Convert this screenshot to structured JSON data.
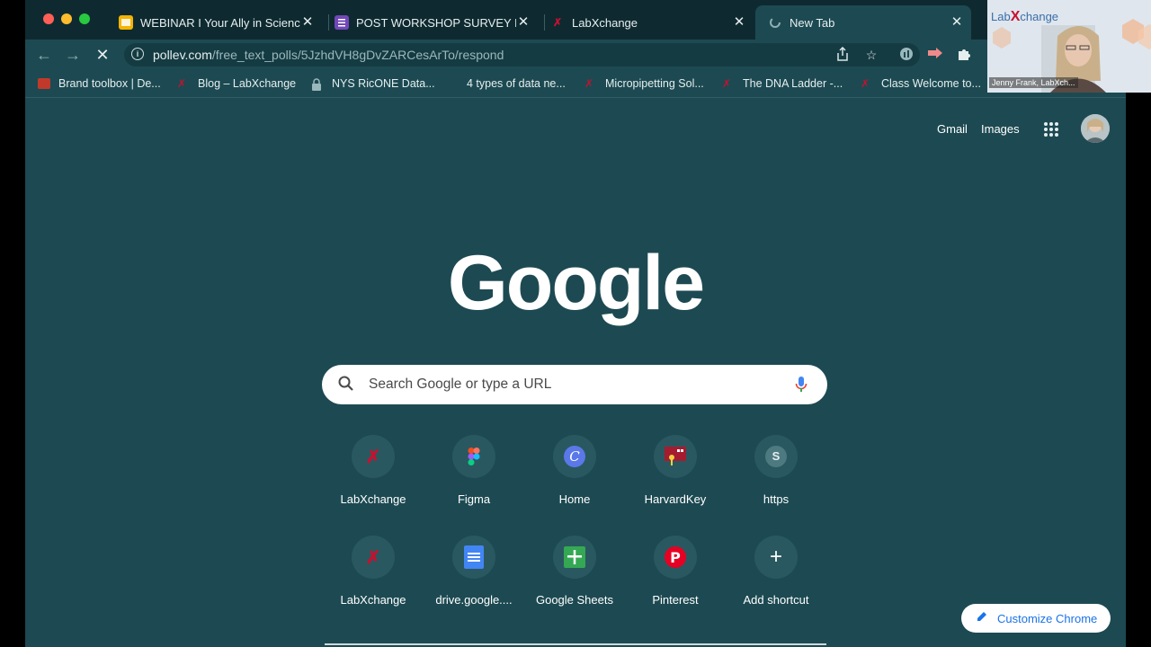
{
  "window": {
    "traffic_colors": [
      "#ff5f57",
      "#febc2e",
      "#28c840"
    ],
    "tabs": [
      {
        "title": "WEBINAR I Your Ally in Science",
        "icon": "slides-icon",
        "color": "#f4b400"
      },
      {
        "title": "POST WORKSHOP SURVEY I A",
        "icon": "forms-icon",
        "color": "#7248b9"
      },
      {
        "title": "LabXchange",
        "icon": "labxchange-icon",
        "color": "#c8102e"
      },
      {
        "title": "New Tab",
        "icon": "loading-icon",
        "color": "#8fb0b4",
        "active": true
      }
    ]
  },
  "toolbar": {
    "url_host": "pollev.com",
    "url_path": "/free_text_polls/5JzhdVH8gDvZARCesArTo/respond"
  },
  "bookmarks": [
    {
      "label": "Brand toolbox | De...",
      "color": "#c0392b"
    },
    {
      "label": "Blog – LabXchange",
      "color": "#c8102e"
    },
    {
      "label": "NYS RicONE Data...",
      "color": "#9ab7bb"
    },
    {
      "label": "4 types of data ne...",
      "color": "#1d4a52"
    },
    {
      "label": "Micropipetting Sol...",
      "color": "#c8102e"
    },
    {
      "label": "The DNA Ladder -...",
      "color": "#c8102e"
    },
    {
      "label": "Class Welcome to...",
      "color": "#c8102e"
    }
  ],
  "ntp": {
    "gmail": "Gmail",
    "images": "Images",
    "logo": "Google",
    "search_placeholder": "Search Google or type a URL",
    "shortcuts_row1": [
      {
        "label": "LabXchange",
        "icon": "labxchange-icon"
      },
      {
        "label": "Figma",
        "icon": "figma-icon"
      },
      {
        "label": "Home",
        "icon": "canva-icon"
      },
      {
        "label": "HarvardKey",
        "icon": "harvardkey-icon"
      },
      {
        "label": "https",
        "icon": "letter-s-icon",
        "letter": "S"
      }
    ],
    "shortcuts_row2": [
      {
        "label": "LabXchange",
        "icon": "labxchange-icon"
      },
      {
        "label": "drive.google....",
        "icon": "docs-icon"
      },
      {
        "label": "Google Sheets",
        "icon": "sheets-icon"
      },
      {
        "label": "Pinterest",
        "icon": "pinterest-icon"
      },
      {
        "label": "Add shortcut",
        "icon": "plus-icon"
      }
    ],
    "customize_label": "Customize Chrome"
  },
  "camera": {
    "participant_name": "Jenny Frank, LabXch...",
    "brand_prefix": "Lab",
    "brand_x": "X",
    "brand_suffix": "change"
  }
}
